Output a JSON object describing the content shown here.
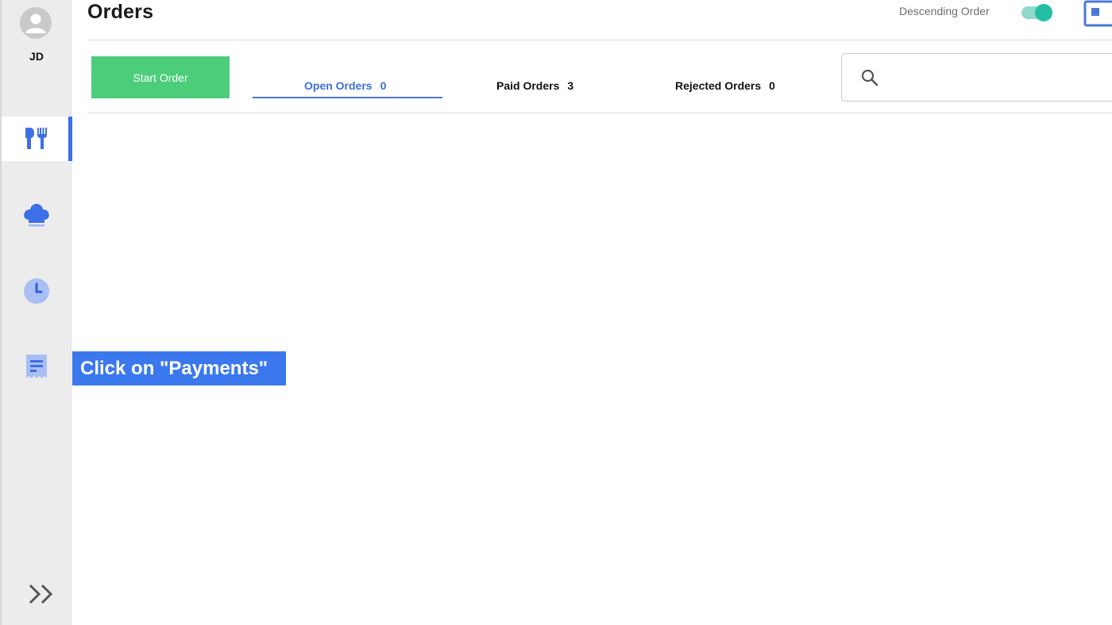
{
  "user": {
    "initials": "JD"
  },
  "sidebar": {
    "items": [
      {
        "name": "dine-in",
        "icon": "utensils-icon",
        "active": true
      },
      {
        "name": "kitchen",
        "icon": "chef-hat-icon",
        "active": false
      },
      {
        "name": "history",
        "icon": "clock-icon",
        "active": false
      },
      {
        "name": "payments",
        "icon": "receipt-icon",
        "active": false
      }
    ],
    "expand_icon": "double-chevron-right-icon"
  },
  "header": {
    "title": "Orders",
    "sort_label": "Descending Order",
    "sort_descending": true
  },
  "toolbar": {
    "start_order_label": "Start Order",
    "tabs": [
      {
        "label": "Open Orders",
        "count": "0",
        "active": true
      },
      {
        "label": "Paid Orders",
        "count": "3",
        "active": false
      },
      {
        "label": "Rejected Orders",
        "count": "0",
        "active": false
      }
    ],
    "search": {
      "placeholder": "",
      "value": ""
    }
  },
  "tooltip": {
    "text": "Click on \"Payments\""
  },
  "colors": {
    "accent": "#3d6fe6",
    "start_button": "#4ccd7a",
    "toggle_on": "#24bfa2",
    "tooltip_bg": "#3b78ee",
    "sidebar_bg": "#ececed"
  }
}
